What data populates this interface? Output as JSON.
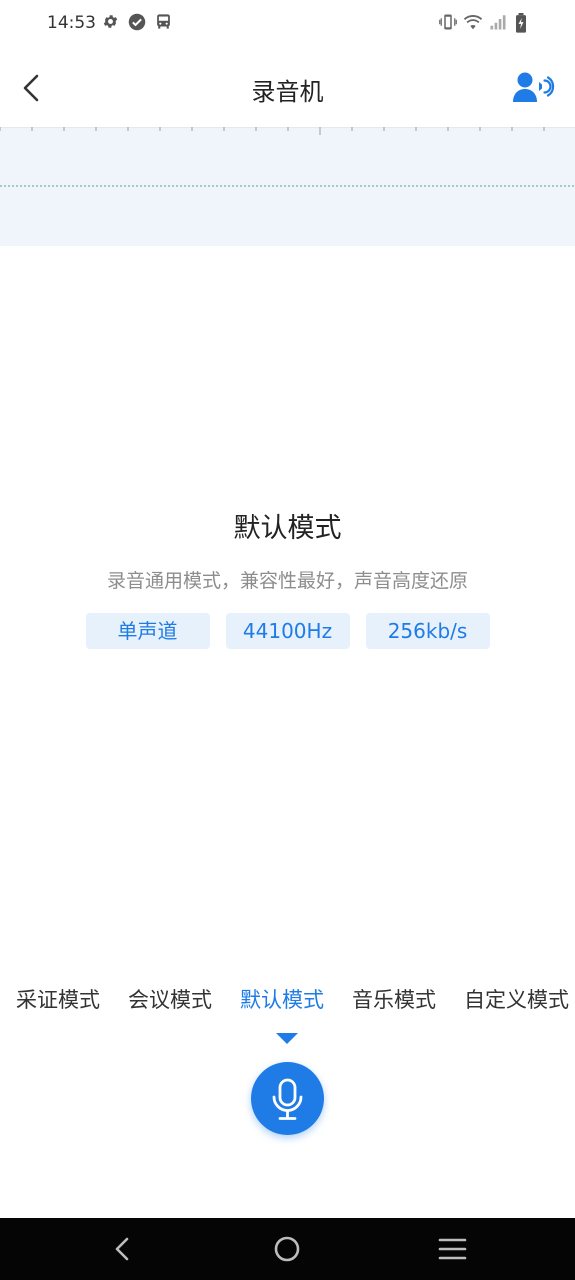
{
  "status_bar": {
    "time": "14:53",
    "left_icons": [
      "settings-icon",
      "check-circle-icon",
      "bus-icon"
    ],
    "right_icons": [
      "vibrate-icon",
      "wifi-icon",
      "signal-icon",
      "battery-charging-icon"
    ]
  },
  "header": {
    "title": "录音机",
    "back_icon": "chevron-left-icon",
    "action_icon": "voice-person-icon"
  },
  "mode_detail": {
    "title": "默认模式",
    "description": "录音通用模式，兼容性最好，声音高度还原",
    "tags": [
      "单声道",
      "44100Hz",
      "256kb/s"
    ]
  },
  "modes": {
    "items": [
      "采证模式",
      "会议模式",
      "默认模式",
      "音乐模式",
      "自定义模式"
    ],
    "selected": "默认模式"
  },
  "record_button": {
    "icon": "microphone-icon"
  },
  "nav_bar": {
    "icons": [
      "nav-back-icon",
      "nav-home-icon",
      "nav-menu-icon"
    ]
  },
  "colors": {
    "accent": "#1f7be6",
    "tag_bg": "#e7f1fc",
    "wave_bg": "#eff5fb",
    "nav_bg": "#050505",
    "desc_text": "#8d8d8d"
  }
}
